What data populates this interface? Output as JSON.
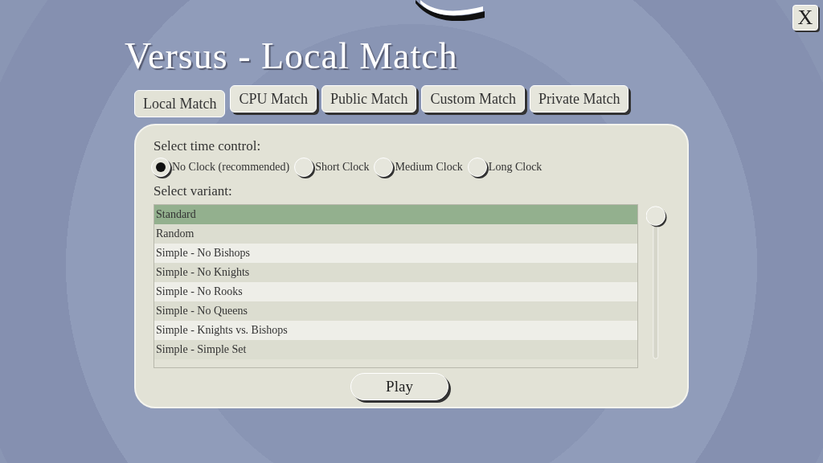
{
  "close_button": {
    "label": "X"
  },
  "title": "Versus - Local Match",
  "tabs": [
    {
      "label": "Local Match",
      "selected": true
    },
    {
      "label": "CPU Match",
      "selected": false
    },
    {
      "label": "Public Match",
      "selected": false
    },
    {
      "label": "Custom Match",
      "selected": false
    },
    {
      "label": "Private Match",
      "selected": false
    }
  ],
  "time_control": {
    "label": "Select time control:",
    "options": [
      {
        "label": "No Clock (recommended)",
        "selected": true
      },
      {
        "label": "Short Clock",
        "selected": false
      },
      {
        "label": "Medium Clock",
        "selected": false
      },
      {
        "label": "Long Clock",
        "selected": false
      }
    ]
  },
  "variant": {
    "label": "Select variant:",
    "items": [
      {
        "label": "Standard",
        "selected": true
      },
      {
        "label": "Random",
        "selected": false
      },
      {
        "label": "Simple - No Bishops",
        "selected": false
      },
      {
        "label": "Simple - No Knights",
        "selected": false
      },
      {
        "label": "Simple - No Rooks",
        "selected": false
      },
      {
        "label": "Simple - No Queens",
        "selected": false
      },
      {
        "label": "Simple - Knights vs. Bishops",
        "selected": false
      },
      {
        "label": "Simple - Simple Set",
        "selected": false
      }
    ]
  },
  "play_button": {
    "label": "Play"
  }
}
